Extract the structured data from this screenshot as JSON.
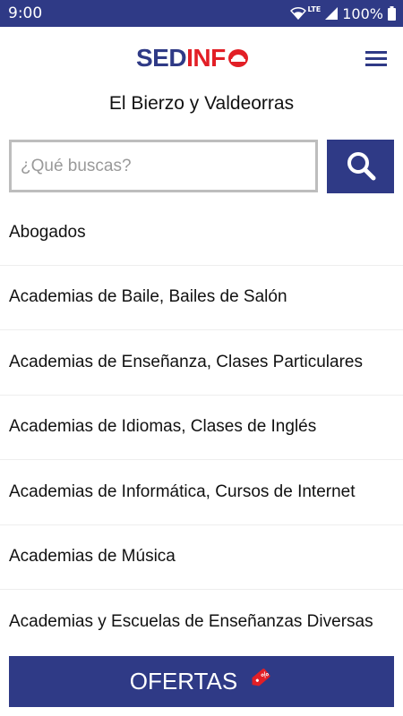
{
  "status_bar": {
    "time": "9:00",
    "network": "LTE",
    "battery": "100%",
    "icons": [
      "wifi-icon",
      "signal-icon",
      "battery-icon"
    ]
  },
  "header": {
    "logo_part1": "SED",
    "logo_part2": "INF",
    "menu_icon": "hamburger-menu-icon"
  },
  "region_title": "El Bierzo y Valdeorras",
  "search": {
    "placeholder": "¿Qué buscas?",
    "value": "",
    "button_icon": "search-icon"
  },
  "categories": [
    "Abogados",
    "Academias de Baile, Bailes de Salón",
    "Academias de Enseñanza, Clases Particulares",
    "Academias de Idiomas, Clases de Inglés",
    "Academias de Informática, Cursos de Internet",
    "Academias de Música",
    "Academias y Escuelas de Enseñanzas Diversas"
  ],
  "offers": {
    "label": "OFERTAS",
    "icon": "discount-tag-icon"
  },
  "colors": {
    "brand_blue": "#2f3a86",
    "brand_red": "#e21f26"
  }
}
